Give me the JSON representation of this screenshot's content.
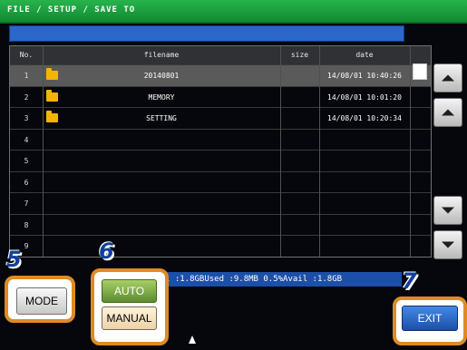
{
  "title": "FILE / SETUP / SAVE TO",
  "table": {
    "headers": {
      "no": "No.",
      "filename": "filename",
      "size": "size",
      "date": "date"
    },
    "rows": [
      {
        "no": "1",
        "filename": "20140801",
        "size": "",
        "date": "14/08/01 10:40:26",
        "folder": true,
        "selected": true
      },
      {
        "no": "2",
        "filename": "MEMORY",
        "size": "",
        "date": "14/08/01 10:01:20",
        "folder": true
      },
      {
        "no": "3",
        "filename": "SETTING",
        "size": "",
        "date": "14/08/01 10:20:34",
        "folder": true
      },
      {
        "no": "4",
        "filename": "",
        "size": "",
        "date": ""
      },
      {
        "no": "5",
        "filename": "",
        "size": "",
        "date": ""
      },
      {
        "no": "6",
        "filename": "",
        "size": "",
        "date": ""
      },
      {
        "no": "7",
        "filename": "",
        "size": "",
        "date": ""
      },
      {
        "no": "8",
        "filename": "",
        "size": "",
        "date": ""
      },
      {
        "no": "9",
        "filename": "",
        "size": "",
        "date": ""
      }
    ]
  },
  "status": "l :1.8GBUsed :9.8MB 0.5%Avail :1.8GB",
  "buttons": {
    "mode": "MODE",
    "auto": "AUTO",
    "manual": "MANUAL",
    "exit": "EXIT"
  },
  "callouts": {
    "mode": "5",
    "auto_manual": "6",
    "exit": "7"
  },
  "icons": {
    "folder": "folder-icon",
    "page_up": "page-up-icon",
    "line_up": "scroll-up-icon",
    "line_down": "scroll-down-icon",
    "page_down": "page-down-icon"
  },
  "colors": {
    "title_green": "#1a9b3a",
    "panel_black": "#05070c",
    "highlight_blue": "#2a67c8",
    "callout_orange": "#e08a24",
    "callout_number": "#123f9e",
    "folder_yellow": "#f5b400"
  }
}
